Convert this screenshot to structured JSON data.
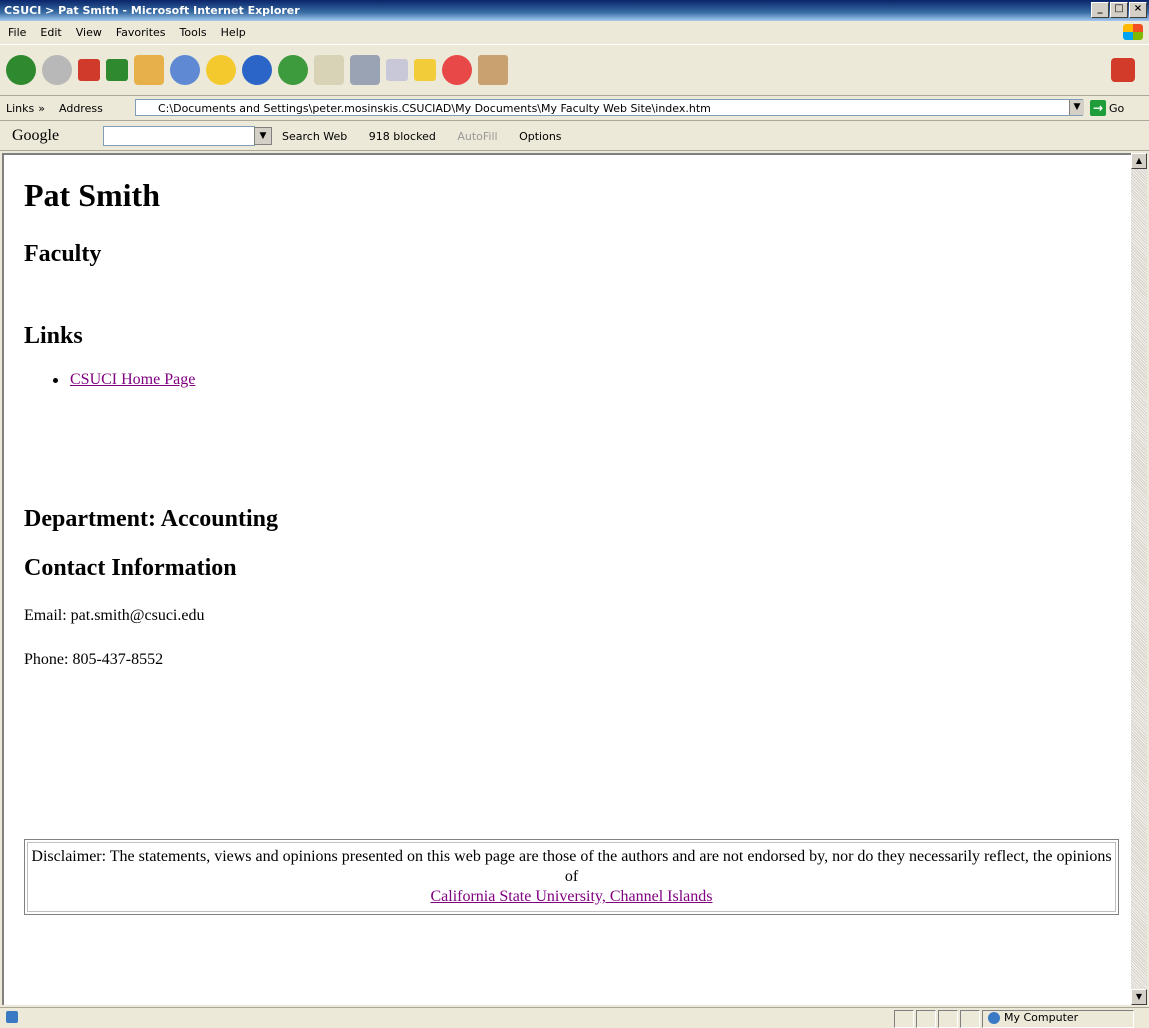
{
  "window": {
    "title": "CSUCI > Pat Smith - Microsoft Internet Explorer",
    "min_label": "_",
    "max_label": "□",
    "close_label": "×"
  },
  "menu": [
    "File",
    "Edit",
    "View",
    "Favorites",
    "Tools",
    "Help"
  ],
  "address_bar": {
    "links_label": "Links",
    "links_chevron": "»",
    "label": "Address",
    "value": "C:\\Documents and Settings\\peter.mosinskis.CSUCIAD\\My Documents\\My Faculty Web Site\\index.htm",
    "go_label": "Go"
  },
  "google_toolbar": {
    "logo": "Google",
    "search_web": "Search Web",
    "blocked": "918 blocked",
    "autofill": "AutoFill",
    "options": "Options"
  },
  "page": {
    "name": "Pat Smith",
    "role": "Faculty",
    "links_heading": "Links",
    "link_home": "CSUCI Home Page",
    "department": "Department: Accounting",
    "contact_heading": "Contact Information",
    "email": "Email: pat.smith@csuci.edu",
    "phone": "Phone: 805-437-8552",
    "disclaimer_text": "Disclaimer: The statements, views and opinions presented on this web page are those of the authors and are not endorsed by, nor do they necessarily reflect, the opinions of",
    "disclaimer_link": "California State University, Channel Islands"
  },
  "status": {
    "zone": "My Computer"
  }
}
